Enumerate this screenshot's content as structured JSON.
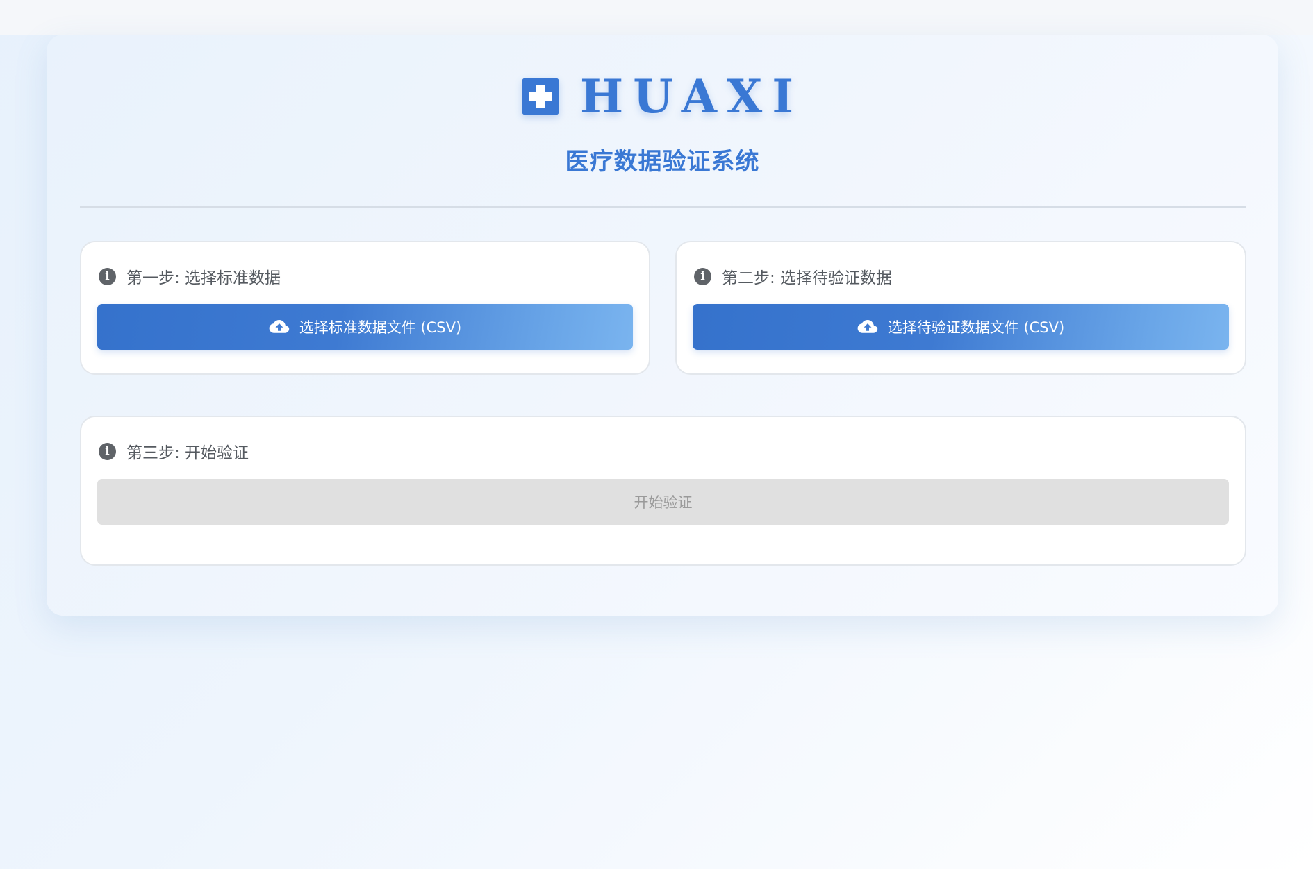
{
  "brand": {
    "name": "HUAXI",
    "subtitle": "医疗数据验证系统",
    "accent_color": "#3a78d4",
    "icon": "medical-cross-icon"
  },
  "steps": [
    {
      "title": "第一步: 选择标准数据",
      "button_label": "选择标准数据文件 (CSV)",
      "button_icon": "cloud-upload-icon"
    },
    {
      "title": "第二步: 选择待验证数据",
      "button_label": "选择待验证数据文件 (CSV)",
      "button_icon": "cloud-upload-icon"
    },
    {
      "title": "第三步: 开始验证",
      "button_label": "开始验证",
      "button_state": "disabled"
    }
  ],
  "colors": {
    "primary": "#3a78d4",
    "primary_light": "#7ab4ef",
    "disabled_bg": "#e0e0e0",
    "disabled_text": "#9a9a9a"
  }
}
